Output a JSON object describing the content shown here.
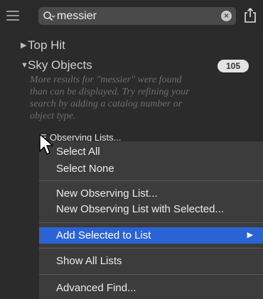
{
  "search": {
    "value": "messier"
  },
  "sections": {
    "top_hit": "Top Hit",
    "sky_objects": "Sky Objects",
    "sky_objects_count": "105",
    "notice": "More results for \"messier\" were found than can be displayed. Try refining your search by adding a catalog number or object type."
  },
  "observing_lists_label": "Observing Lists...",
  "menu": {
    "items": [
      {
        "label": "Select All"
      },
      {
        "label": "Select None"
      },
      {
        "label": "New Observing List..."
      },
      {
        "label": "New Observing List with Selected..."
      },
      {
        "label": "Add Selected to List",
        "selected": true,
        "has_submenu": true
      },
      {
        "label": "Show All Lists"
      },
      {
        "label": "Advanced Find..."
      }
    ]
  },
  "colors": {
    "background": "#2b2b2b",
    "menu_background": "#3c3c3c",
    "highlight": "#2a63d6",
    "badge": "#e3e3e3"
  },
  "icons": [
    "hamburger-icon",
    "search-icon",
    "clear-icon",
    "share-icon",
    "disclosure-icon",
    "submenu-arrow-icon",
    "cursor-icon"
  ]
}
